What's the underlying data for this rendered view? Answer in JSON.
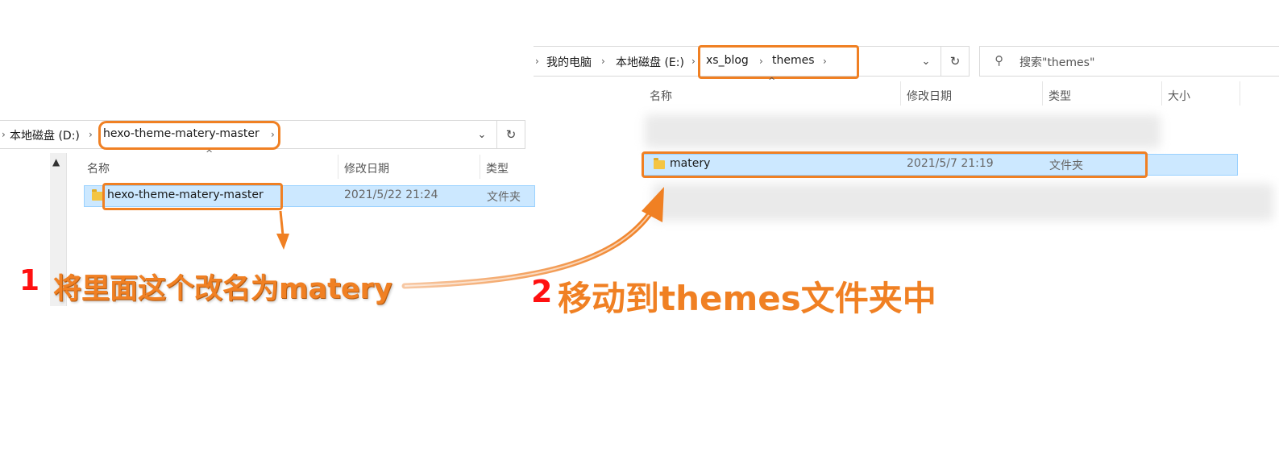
{
  "left_explorer": {
    "breadcrumb": [
      "本地磁盘 (D:)",
      "hexo-theme-matery-master"
    ],
    "columns": [
      "名称",
      "修改日期",
      "类型"
    ],
    "rows": [
      {
        "name": "hexo-theme-matery-master",
        "modified": "2021/5/22 21:24",
        "type": "文件夹"
      }
    ]
  },
  "right_explorer": {
    "breadcrumb": [
      "我的电脑",
      "本地磁盘 (E:)",
      "xs_blog",
      "themes"
    ],
    "search_placeholder": "搜索\"themes\"",
    "columns": [
      "名称",
      "修改日期",
      "类型",
      "大小"
    ],
    "rows": [
      {
        "name": "matery",
        "modified": "2021/5/7 21:19",
        "type": "文件夹"
      }
    ]
  },
  "annotations": {
    "step1_number": "1",
    "step1_text": "将里面这个改名为matery",
    "step2_number": "2",
    "step2_text": "移动到themes文件夹中"
  },
  "colors": {
    "highlight": "#f08023",
    "selection": "#cce8ff",
    "step1_number": "#ff1010"
  }
}
